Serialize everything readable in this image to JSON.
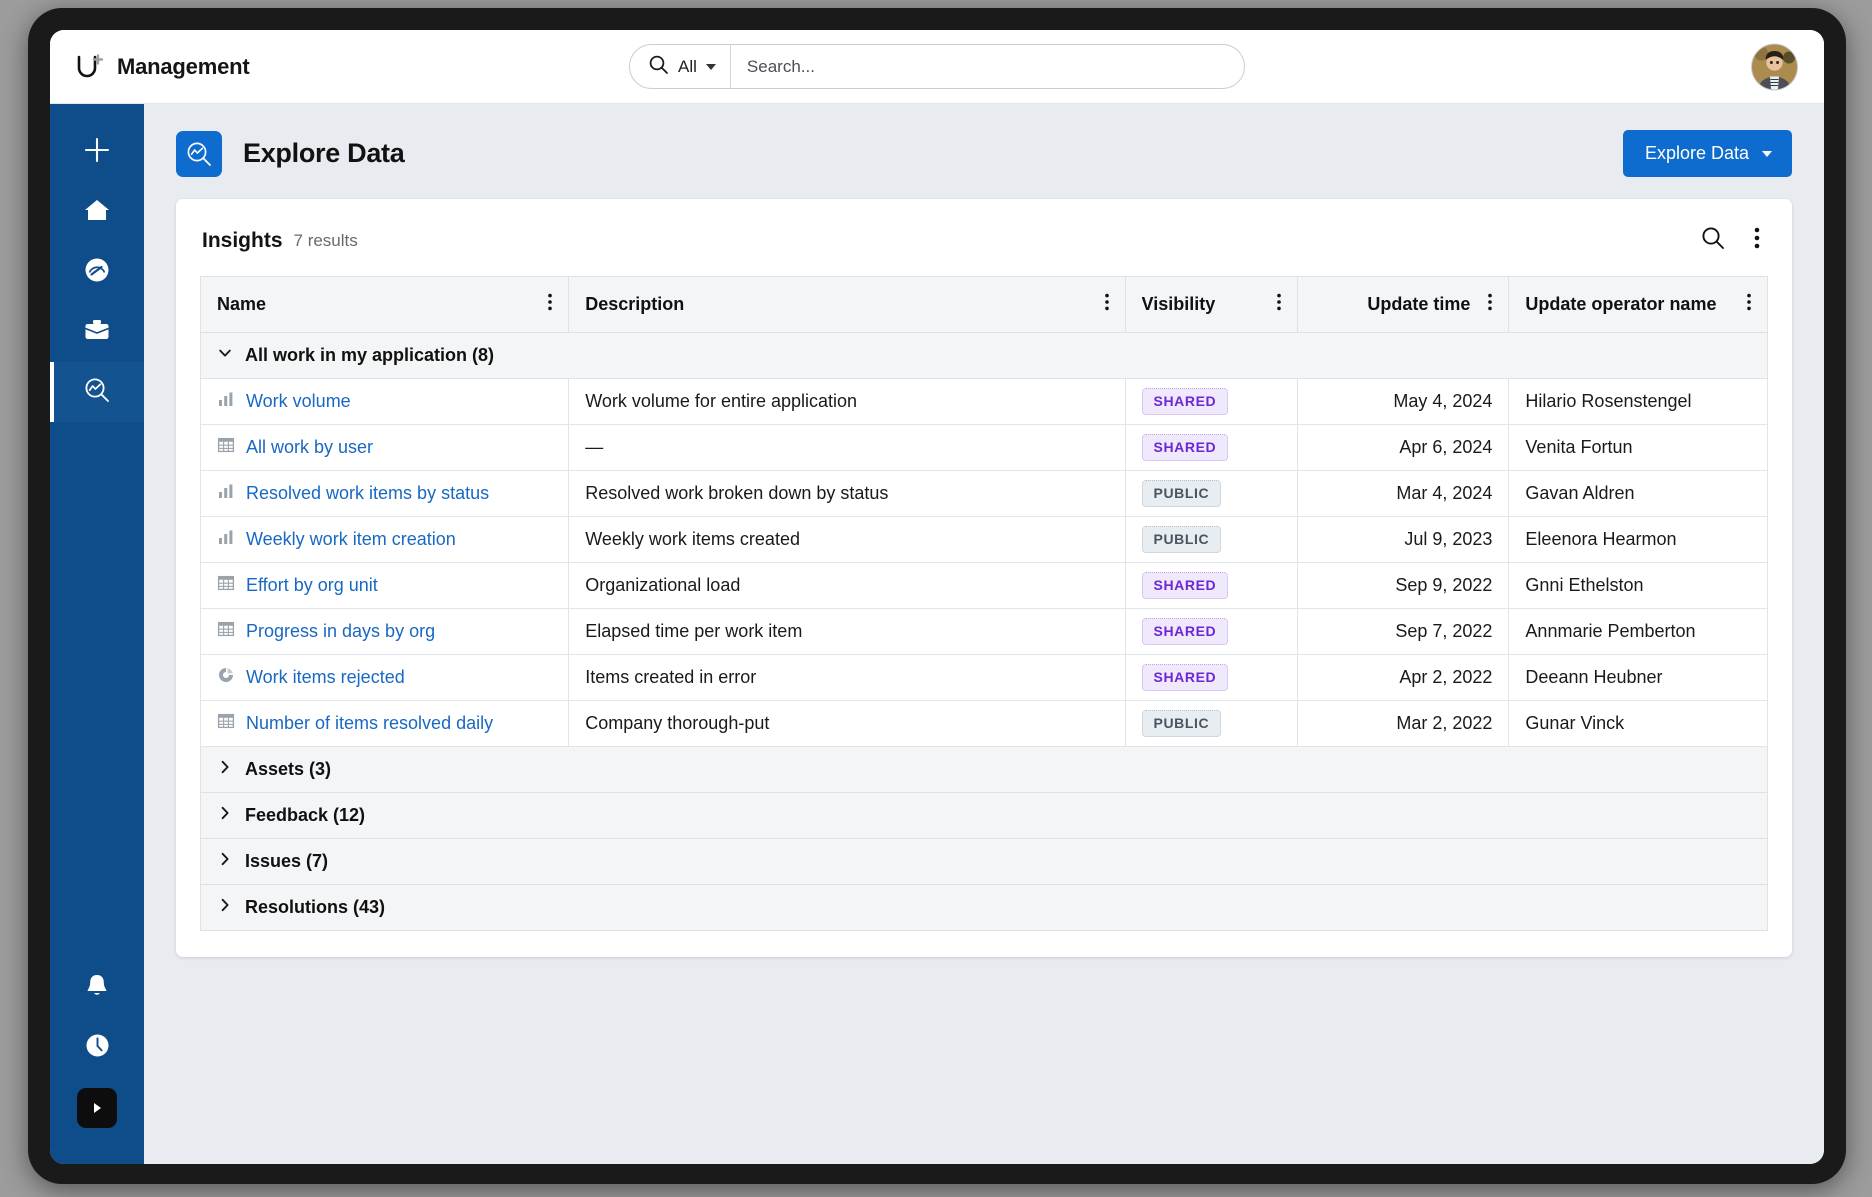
{
  "topbar": {
    "brand_title": "Management",
    "brand_icon": "u-plus-logo-icon",
    "search": {
      "scope_label": "All",
      "scope_icon": "search-icon",
      "placeholder": "Search...",
      "value": ""
    },
    "avatar_name": "user-avatar"
  },
  "sidebar": {
    "items": [
      {
        "icon": "plus-icon",
        "name": "create",
        "active": false
      },
      {
        "icon": "home-icon",
        "name": "home",
        "active": false
      },
      {
        "icon": "gauge-icon",
        "name": "dashboards",
        "active": false
      },
      {
        "icon": "briefcase-icon",
        "name": "work",
        "active": false
      },
      {
        "icon": "explore-data-icon",
        "name": "explore-data",
        "active": true
      }
    ],
    "bottom_items": [
      {
        "icon": "bell-icon",
        "name": "notifications"
      },
      {
        "icon": "clock-icon",
        "name": "recent"
      },
      {
        "icon": "play-icon",
        "name": "media"
      }
    ]
  },
  "page": {
    "icon": "explore-data-icon",
    "title": "Explore Data",
    "primary_button": {
      "label": "Explore Data",
      "caret_icon": "chevron-down-icon",
      "color": "#0f6ccf"
    }
  },
  "card": {
    "title": "Insights",
    "count_label": "7 results",
    "actions": [
      {
        "icon": "search-icon",
        "name": "card-search"
      },
      {
        "icon": "kebab-menu-icon",
        "name": "card-more"
      }
    ]
  },
  "table": {
    "columns": [
      {
        "label": "Name",
        "align": "left",
        "menu_icon": "kebab-menu-icon"
      },
      {
        "label": "Description",
        "align": "left",
        "menu_icon": "kebab-menu-icon"
      },
      {
        "label": "Visibility",
        "align": "left",
        "menu_icon": "kebab-menu-icon"
      },
      {
        "label": "Update time",
        "align": "right",
        "menu_icon": "kebab-menu-icon"
      },
      {
        "label": "Update operator name",
        "align": "left",
        "menu_icon": "kebab-menu-icon"
      }
    ],
    "groups": [
      {
        "label": "All work in my application (8)",
        "expanded": true,
        "chevron_icon": "chevron-down-icon",
        "rows": [
          {
            "icon": "bar-chart-icon",
            "name": "Work volume",
            "description": "Work volume for entire application",
            "visibility": "SHARED",
            "update_time": "May 4, 2024",
            "operator": "Hilario Rosenstengel"
          },
          {
            "icon": "table-grid-icon",
            "name": "All work by user",
            "description": "—",
            "visibility": "SHARED",
            "update_time": "Apr 6, 2024",
            "operator": "Venita Fortun"
          },
          {
            "icon": "bar-chart-icon",
            "name": "Resolved work items by status",
            "description": "Resolved work broken down by status",
            "visibility": "PUBLIC",
            "update_time": "Mar 4, 2024",
            "operator": "Gavan Aldren"
          },
          {
            "icon": "bar-chart-icon",
            "name": "Weekly work item creation",
            "description": "Weekly work items created",
            "visibility": "PUBLIC",
            "update_time": "Jul 9, 2023",
            "operator": "Eleenora Hearmon"
          },
          {
            "icon": "table-grid-icon",
            "name": "Effort by org unit",
            "description": "Organizational load",
            "visibility": "SHARED",
            "update_time": "Sep 9, 2022",
            "operator": "Gnni Ethelston"
          },
          {
            "icon": "table-grid-icon",
            "name": "Progress in days by org",
            "description": "Elapsed time per work item",
            "visibility": "SHARED",
            "update_time": "Sep 7, 2022",
            "operator": "Annmarie Pemberton"
          },
          {
            "icon": "donut-chart-icon",
            "name": "Work items rejected",
            "description": "Items created in error",
            "visibility": "SHARED",
            "update_time": "Apr 2, 2022",
            "operator": "Deeann Heubner"
          },
          {
            "icon": "table-grid-icon",
            "name": "Number of items resolved daily",
            "description": "Company thorough-put",
            "visibility": "PUBLIC",
            "update_time": "Mar 2, 2022",
            "operator": "Gunar Vinck"
          }
        ]
      },
      {
        "label": "Assets (3)",
        "expanded": false,
        "chevron_icon": "chevron-right-icon",
        "rows": []
      },
      {
        "label": "Feedback (12)",
        "expanded": false,
        "chevron_icon": "chevron-right-icon",
        "rows": []
      },
      {
        "label": "Issues (7)",
        "expanded": false,
        "chevron_icon": "chevron-right-icon",
        "rows": []
      },
      {
        "label": "Resolutions (43)",
        "expanded": false,
        "chevron_icon": "chevron-right-icon",
        "rows": []
      }
    ]
  },
  "colors": {
    "sidebar": "#0f4c8a",
    "accent": "#0f6ccf",
    "link": "#1868c4",
    "shared_badge": "#6c27d6",
    "public_badge": "#4a5560",
    "content_bg": "#e8ecf0"
  }
}
